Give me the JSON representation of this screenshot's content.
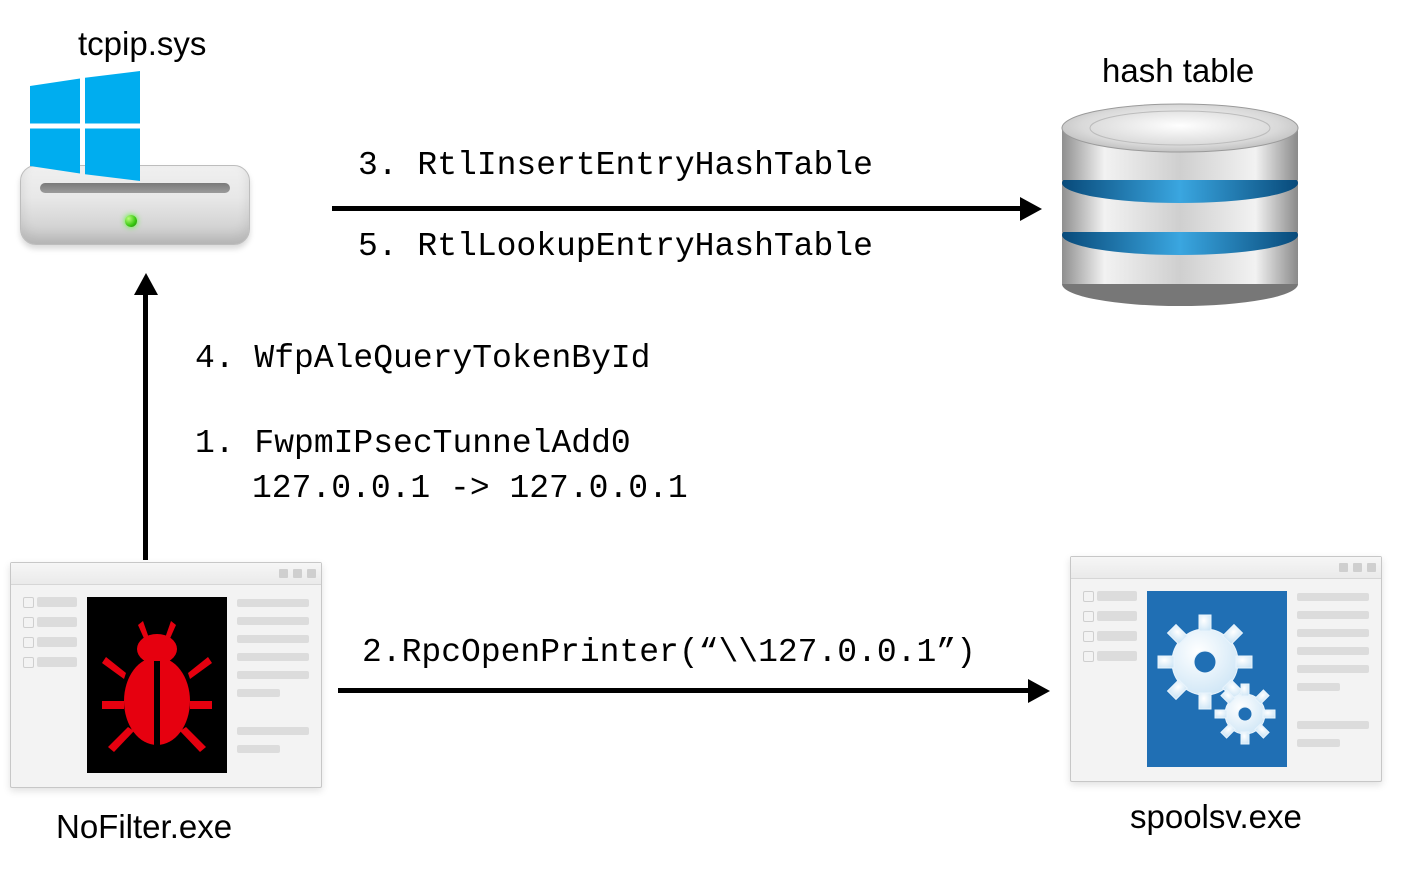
{
  "nodes": {
    "tcpip": {
      "label": "tcpip.sys"
    },
    "hashtable": {
      "label": "hash table"
    },
    "nofilter": {
      "label": "NoFilter.exe"
    },
    "spoolsv": {
      "label": "spoolsv.exe"
    }
  },
  "steps": {
    "s1_line1": "1. FwpmIPsecTunnelAdd0",
    "s1_line2": "127.0.0.1 -> 127.0.0.1",
    "s2": "2.RpcOpenPrinter(“\\\\127.0.0.1”)",
    "s3": "3. RtlInsertEntryHashTable",
    "s4": "4. WfpAleQueryTokenById",
    "s5": "5. RtlLookupEntryHashTable"
  },
  "icons": {
    "windows": "windows-logo-icon",
    "drive": "hard-drive-icon",
    "database": "database-icon",
    "bug": "bug-icon",
    "gears": "gears-icon"
  }
}
